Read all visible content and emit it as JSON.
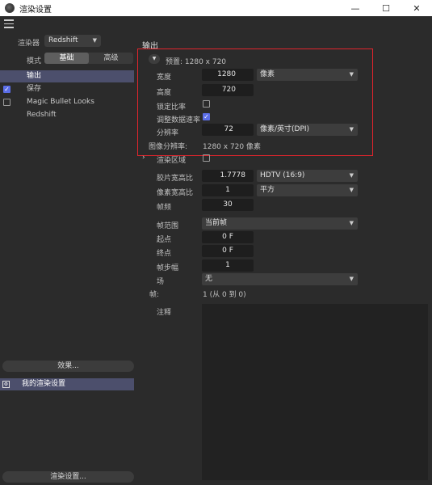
{
  "window": {
    "title": "渲染设置",
    "minimize_glyph": "—",
    "maximize_glyph": "☐",
    "close_glyph": "✕"
  },
  "left": {
    "renderer_label": "渲染器",
    "renderer_value": "Redshift",
    "mode_label": "模式",
    "mode_basic": "基础",
    "mode_advanced": "高级",
    "items": [
      {
        "label": "输出",
        "checked": null,
        "selected": true
      },
      {
        "label": "保存",
        "checked": true,
        "selected": false
      },
      {
        "label": "Magic Bullet Looks",
        "checked": false,
        "selected": false
      },
      {
        "label": "Redshift",
        "checked": null,
        "selected": false
      }
    ],
    "effects_button": "效果...",
    "preset_name": "我的渲染设置",
    "render_settings_button": "渲染设置..."
  },
  "output": {
    "section_title": "输出",
    "preset": "预置: 1280 x 720",
    "width_label": "宽度",
    "width_value": "1280",
    "unit_value": "像素",
    "height_label": "高度",
    "height_value": "720",
    "lock_ratio_label": "锁定比率",
    "lock_ratio_checked": false,
    "adjust_rate_label": "调整数据速率",
    "adjust_rate_checked": true,
    "resolution_label": "分辨率",
    "resolution_value": "72",
    "resolution_unit": "像素/英寸(DPI)",
    "image_res_label": "图像分辨率:",
    "image_res_value": "1280 x 720 像素",
    "render_region_label": "渲染区域",
    "render_region_checked": false,
    "film_aspect_label": "胶片宽高比",
    "film_aspect_value": "1.7778",
    "film_aspect_preset": "HDTV (16:9)",
    "pixel_aspect_label": "像素宽高比",
    "pixel_aspect_value": "1",
    "pixel_aspect_preset": "平方",
    "fps_label": "帧频",
    "fps_value": "30",
    "frame_range_label": "帧范围",
    "frame_range_value": "当前帧",
    "start_label": "起点",
    "start_value": "0 F",
    "end_label": "终点",
    "end_value": "0 F",
    "frame_step_label": "帧步幅",
    "frame_step_value": "1",
    "field_label": "场",
    "field_value": "无",
    "frames_label": "帧:",
    "frames_value": "1 (从 0 到 0)",
    "notes_label": "注释"
  },
  "colors": {
    "accent": "#5b6ee8",
    "selection": "#4c4f6c",
    "highlight_box": "#e0242c"
  }
}
